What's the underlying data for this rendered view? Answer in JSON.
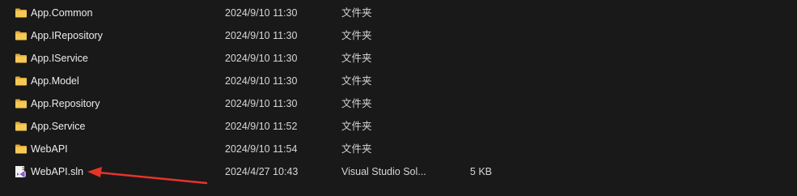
{
  "files": [
    {
      "name": "App.Common",
      "modified": "2024/9/10 11:30",
      "type": "文件夹",
      "size": "",
      "icon": "folder-icon"
    },
    {
      "name": "App.IRepository",
      "modified": "2024/9/10 11:30",
      "type": "文件夹",
      "size": "",
      "icon": "folder-icon"
    },
    {
      "name": "App.IService",
      "modified": "2024/9/10 11:30",
      "type": "文件夹",
      "size": "",
      "icon": "folder-icon"
    },
    {
      "name": "App.Model",
      "modified": "2024/9/10 11:30",
      "type": "文件夹",
      "size": "",
      "icon": "folder-icon"
    },
    {
      "name": "App.Repository",
      "modified": "2024/9/10 11:30",
      "type": "文件夹",
      "size": "",
      "icon": "folder-icon"
    },
    {
      "name": "App.Service",
      "modified": "2024/9/10 11:52",
      "type": "文件夹",
      "size": "",
      "icon": "folder-icon"
    },
    {
      "name": "WebAPI",
      "modified": "2024/9/10 11:54",
      "type": "文件夹",
      "size": "",
      "icon": "folder-icon"
    },
    {
      "name": "WebAPI.sln",
      "modified": "2024/4/27 10:43",
      "type": "Visual Studio Sol...",
      "size": "5 KB",
      "icon": "visual-studio-solution-icon"
    }
  ],
  "colors": {
    "background": "#191919",
    "folder": "#f2c14e",
    "annotation_arrow": "#e8332a",
    "vs_purple": "#8661c5"
  }
}
